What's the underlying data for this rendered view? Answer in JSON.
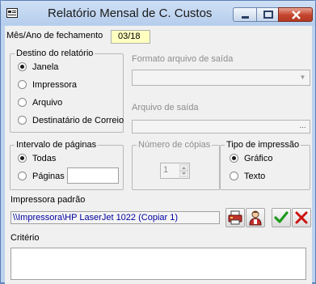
{
  "window": {
    "title": "Relatório Mensal de C. Custos"
  },
  "period": {
    "label": "Mês/Ano de fechamento",
    "value": "03/18"
  },
  "destination": {
    "title": "Destino do relatório",
    "options": [
      {
        "label": "Janela",
        "selected": true
      },
      {
        "label": "Impressora",
        "selected": false
      },
      {
        "label": "Arquivo",
        "selected": false
      },
      {
        "label": "Destinatário de Correio",
        "selected": false
      }
    ]
  },
  "output_format": {
    "label": "Formato arquivo de saída",
    "value": ""
  },
  "output_file": {
    "label": "Arquivo de saída",
    "value": "",
    "browse_label": "..."
  },
  "page_range": {
    "title": "Intervalo de páginas",
    "all_label": "Todas",
    "pages_label": "Páginas",
    "selected": "Todas",
    "pages_value": ""
  },
  "copies": {
    "title": "Número de cópias",
    "value": "1"
  },
  "print_type": {
    "title": "Tipo de impressão",
    "options": [
      {
        "label": "Gráfico",
        "selected": true
      },
      {
        "label": "Texto",
        "selected": false
      }
    ]
  },
  "printer": {
    "label": "Impressora padrão",
    "value": "\\\\Impressora\\HP LaserJet 1022 (Copiar 1)"
  },
  "criteria": {
    "label": "Critério",
    "value": ""
  },
  "colors": {
    "title_bar": "#b5cdec",
    "period_field": "#ffffc0",
    "printer_text": "#0000a0",
    "confirm_green": "#1f9a1f",
    "cancel_red": "#cc1111"
  }
}
